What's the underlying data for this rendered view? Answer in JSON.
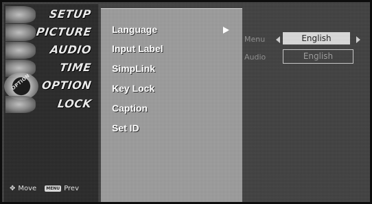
{
  "sidebar": {
    "categories": [
      {
        "id": "setup",
        "label": "SETUP"
      },
      {
        "id": "picture",
        "label": "PICTURE"
      },
      {
        "id": "audio",
        "label": "AUDIO"
      },
      {
        "id": "time",
        "label": "TIME"
      },
      {
        "id": "option",
        "label": "OPTION",
        "active": true,
        "badge": "OPTION"
      },
      {
        "id": "lock",
        "label": "LOCK"
      }
    ],
    "footer": {
      "move_icon": "move-dpad-icon",
      "move_label": "Move",
      "menu_key": "MENU",
      "prev_label": "Prev"
    }
  },
  "main_menu": {
    "items": [
      {
        "label": "Language",
        "selected": true
      },
      {
        "label": "Input Label"
      },
      {
        "label": "SimpLink"
      },
      {
        "label": "Key Lock"
      },
      {
        "label": "Caption"
      },
      {
        "label": "Set ID"
      }
    ],
    "submenu_arrow": "arrow-right-icon"
  },
  "language_panel": {
    "menu": {
      "label": "Menu",
      "value": "English"
    },
    "audio": {
      "label": "Audio",
      "value": "English"
    }
  }
}
